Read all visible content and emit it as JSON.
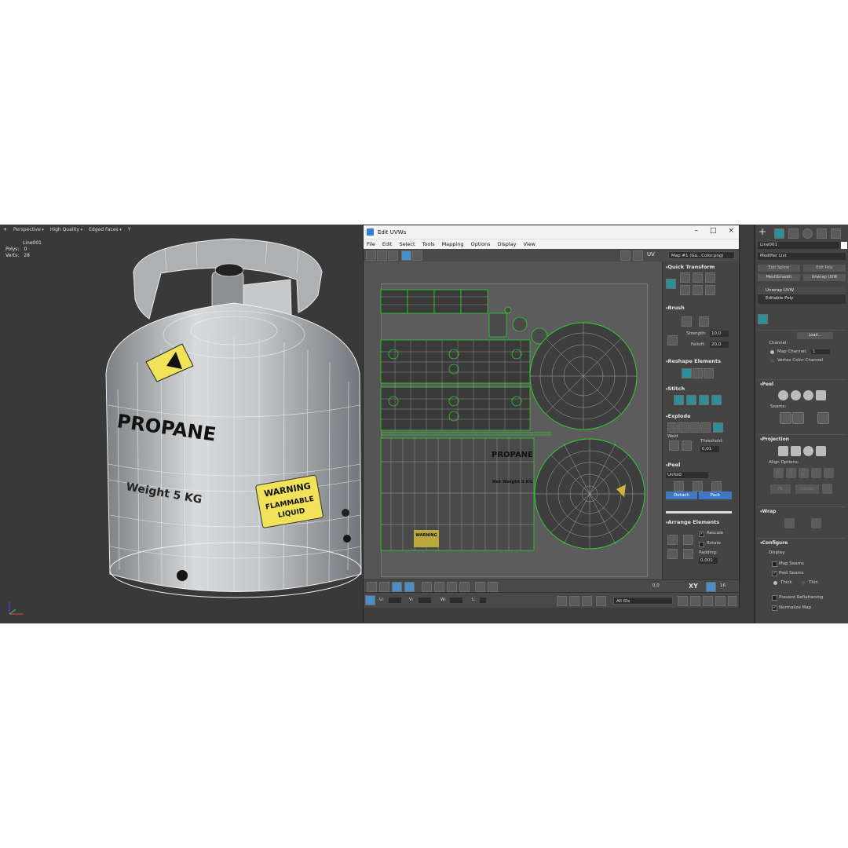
{
  "viewport": {
    "menu": [
      "+",
      "Perspective",
      "High Quality",
      "Edged Faces",
      "Y"
    ],
    "object_name": "Line001",
    "stats": [
      {
        "label": "Polys:",
        "value": "0"
      },
      {
        "label": "Verts:",
        "value": "28"
      }
    ],
    "labels": {
      "warning_title": "WARNING",
      "warning_l1": "FLAMMABLE",
      "warning_l2": "LIQUID",
      "product_name": "PROPANE",
      "weight": "Weight 5 KG"
    }
  },
  "uv_editor": {
    "title": "Edit UVWs",
    "menu": [
      "File",
      "Edit",
      "Select",
      "Tools",
      "Mapping",
      "Options",
      "Display",
      "View"
    ],
    "uv_label": "UV",
    "map_select": "Map #1 (Ga...Color.png)",
    "tex_labels": {
      "propane": "PROPANE",
      "weight": "Net Weight 5 KG",
      "warning": "WARNING"
    },
    "panel": {
      "quick_transform": "Quick Transform",
      "brush": "Brush",
      "strength_label": "Strength:",
      "strength_value": "10,0",
      "falloff_label": "Falloff:",
      "falloff_value": "20,0",
      "reshape": "Reshape Elements",
      "stitch": "Stitch",
      "explode": "Explode",
      "weld": "Weld",
      "threshold_label": "Threshold:",
      "threshold_value": "0,01",
      "peel": "Peel",
      "unfold": "Unfold",
      "detach": "Detach",
      "pack": "Pack",
      "arrange": "Arrange Elements",
      "rescale": "Rescale",
      "rotate": "Rotate",
      "padding_label": "Padding:",
      "padding_value": "0,001"
    },
    "bottom": {
      "value1": "0,0",
      "xy": "XY",
      "value2": "16",
      "u_label": "U:",
      "v_label": "V:",
      "w_label": "W:",
      "l_label": "L:",
      "ids": "All IDs"
    }
  },
  "command_panel": {
    "object_name": "Line001",
    "modifier_list": "Modifier List",
    "buttons": [
      "Edit Spline",
      "Edit Poly",
      "MeshSmooth",
      "Unwrap UVW"
    ],
    "stack": [
      "Unwrap UVW",
      "Editable Poly"
    ],
    "load": "Load...",
    "channel_label": "Channel:",
    "map_channel": "Map Channel:",
    "map_channel_value": "1",
    "vertex_color": "Vertex Color Channel",
    "peel": "Peel",
    "seams": "Seams:",
    "projection": "Projection",
    "align_options": "Align Options:",
    "align_letters": [
      "X",
      "Y",
      "Z"
    ],
    "fit": "Fit",
    "center": "Center",
    "wrap": "Wrap",
    "configure": "Configure",
    "display": "Display:",
    "map_seams": "Map Seams",
    "peel_seams": "Peel Seams",
    "thick": "Thick",
    "thin": "Thin",
    "prevent": "Prevent Reflattening",
    "normalize": "Normalize Map"
  },
  "colors": {
    "accent_blue": "#3f79c4",
    "uv_green": "#2bd12b",
    "label_yellow": "#f2e25a"
  }
}
